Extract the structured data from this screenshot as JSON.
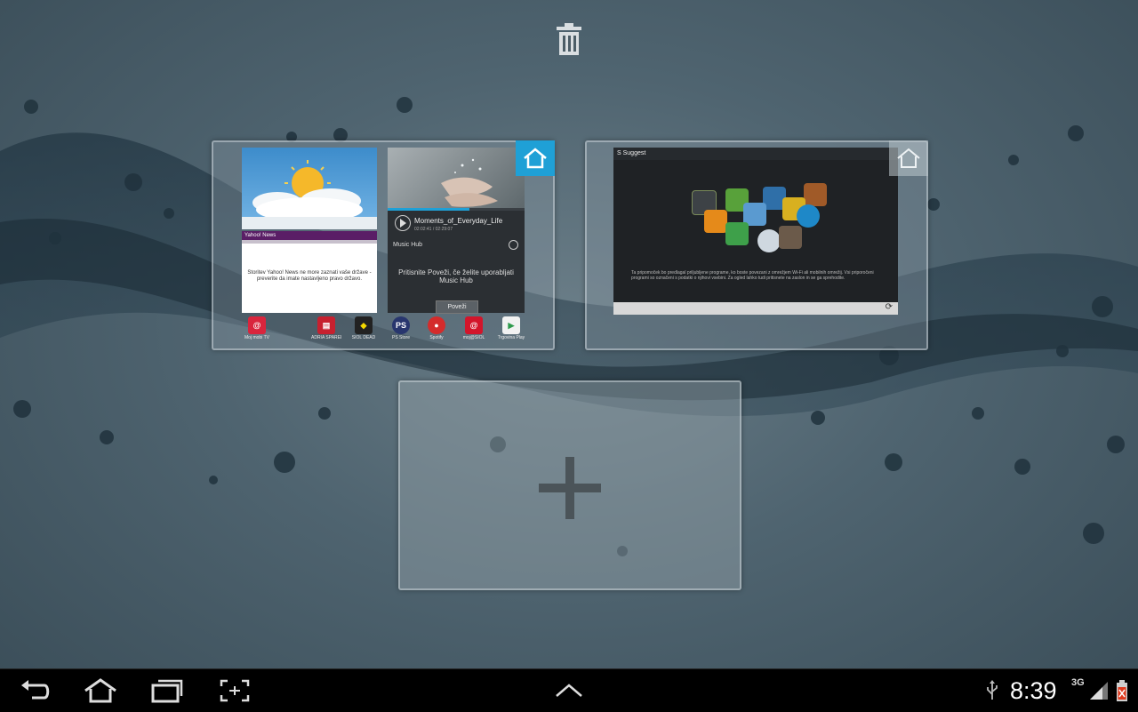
{
  "panel1": {
    "news_header": "Yahoo! News",
    "news_body": "Storitev Yahoo! News ne more zaznati vaše države - preverite da imate nastavljeno pravo državo.",
    "music_track_title": "Moments_of_Everyday_Life",
    "music_track_time": "02:02:41 / 02:29:07",
    "music_hub_label": "Music Hub",
    "music_prompt": "Pritisnite Poveži, če želite uporabljati Music Hub",
    "music_connect_button": "Poveži",
    "dock_apps": [
      {
        "label": "Moj mobi TV",
        "color": "#d9253d",
        "glyph": "@"
      },
      {
        "label": "ADRIA SPAREKOR",
        "color": "#c7202f",
        "glyph": "▤"
      },
      {
        "label": "SIOL DEAD",
        "color": "#222222",
        "glyph": "◆"
      },
      {
        "label": "PS Store",
        "color": "#28366e",
        "glyph": "PS"
      },
      {
        "label": "Spotify",
        "color": "#d42b2b",
        "glyph": "●"
      },
      {
        "label": "moj@SIOL",
        "color": "#d3152b",
        "glyph": "@"
      },
      {
        "label": "Trgovina Play",
        "color": "#f2f2f2",
        "glyph": "▶"
      }
    ]
  },
  "panel2": {
    "header": "S Suggest",
    "description": "Ta pripomoček bo predlagal priljubljene programe, ko boste povezani z omrežjem Wi-Fi ali mobilnih omrežij. Vsi priporočeni programi so označeni s podatki o njihovi vsebini. Za ogled lahko tudi pritisnete na zaslon in se ga sprehodite."
  },
  "status": {
    "time": "8:39",
    "network": "3G"
  },
  "colors": {
    "accent": "#1fa0d6",
    "battery": "#e03a1e"
  },
  "icons": {
    "trash": "trash-icon",
    "home": "home-icon",
    "plus": "plus-icon",
    "back": "back-icon",
    "recent": "recent-apps-icon",
    "screenshot": "screenshot-icon",
    "up": "chevron-up-icon",
    "usb": "usb-icon",
    "signal": "signal-icon",
    "battery": "battery-icon"
  }
}
